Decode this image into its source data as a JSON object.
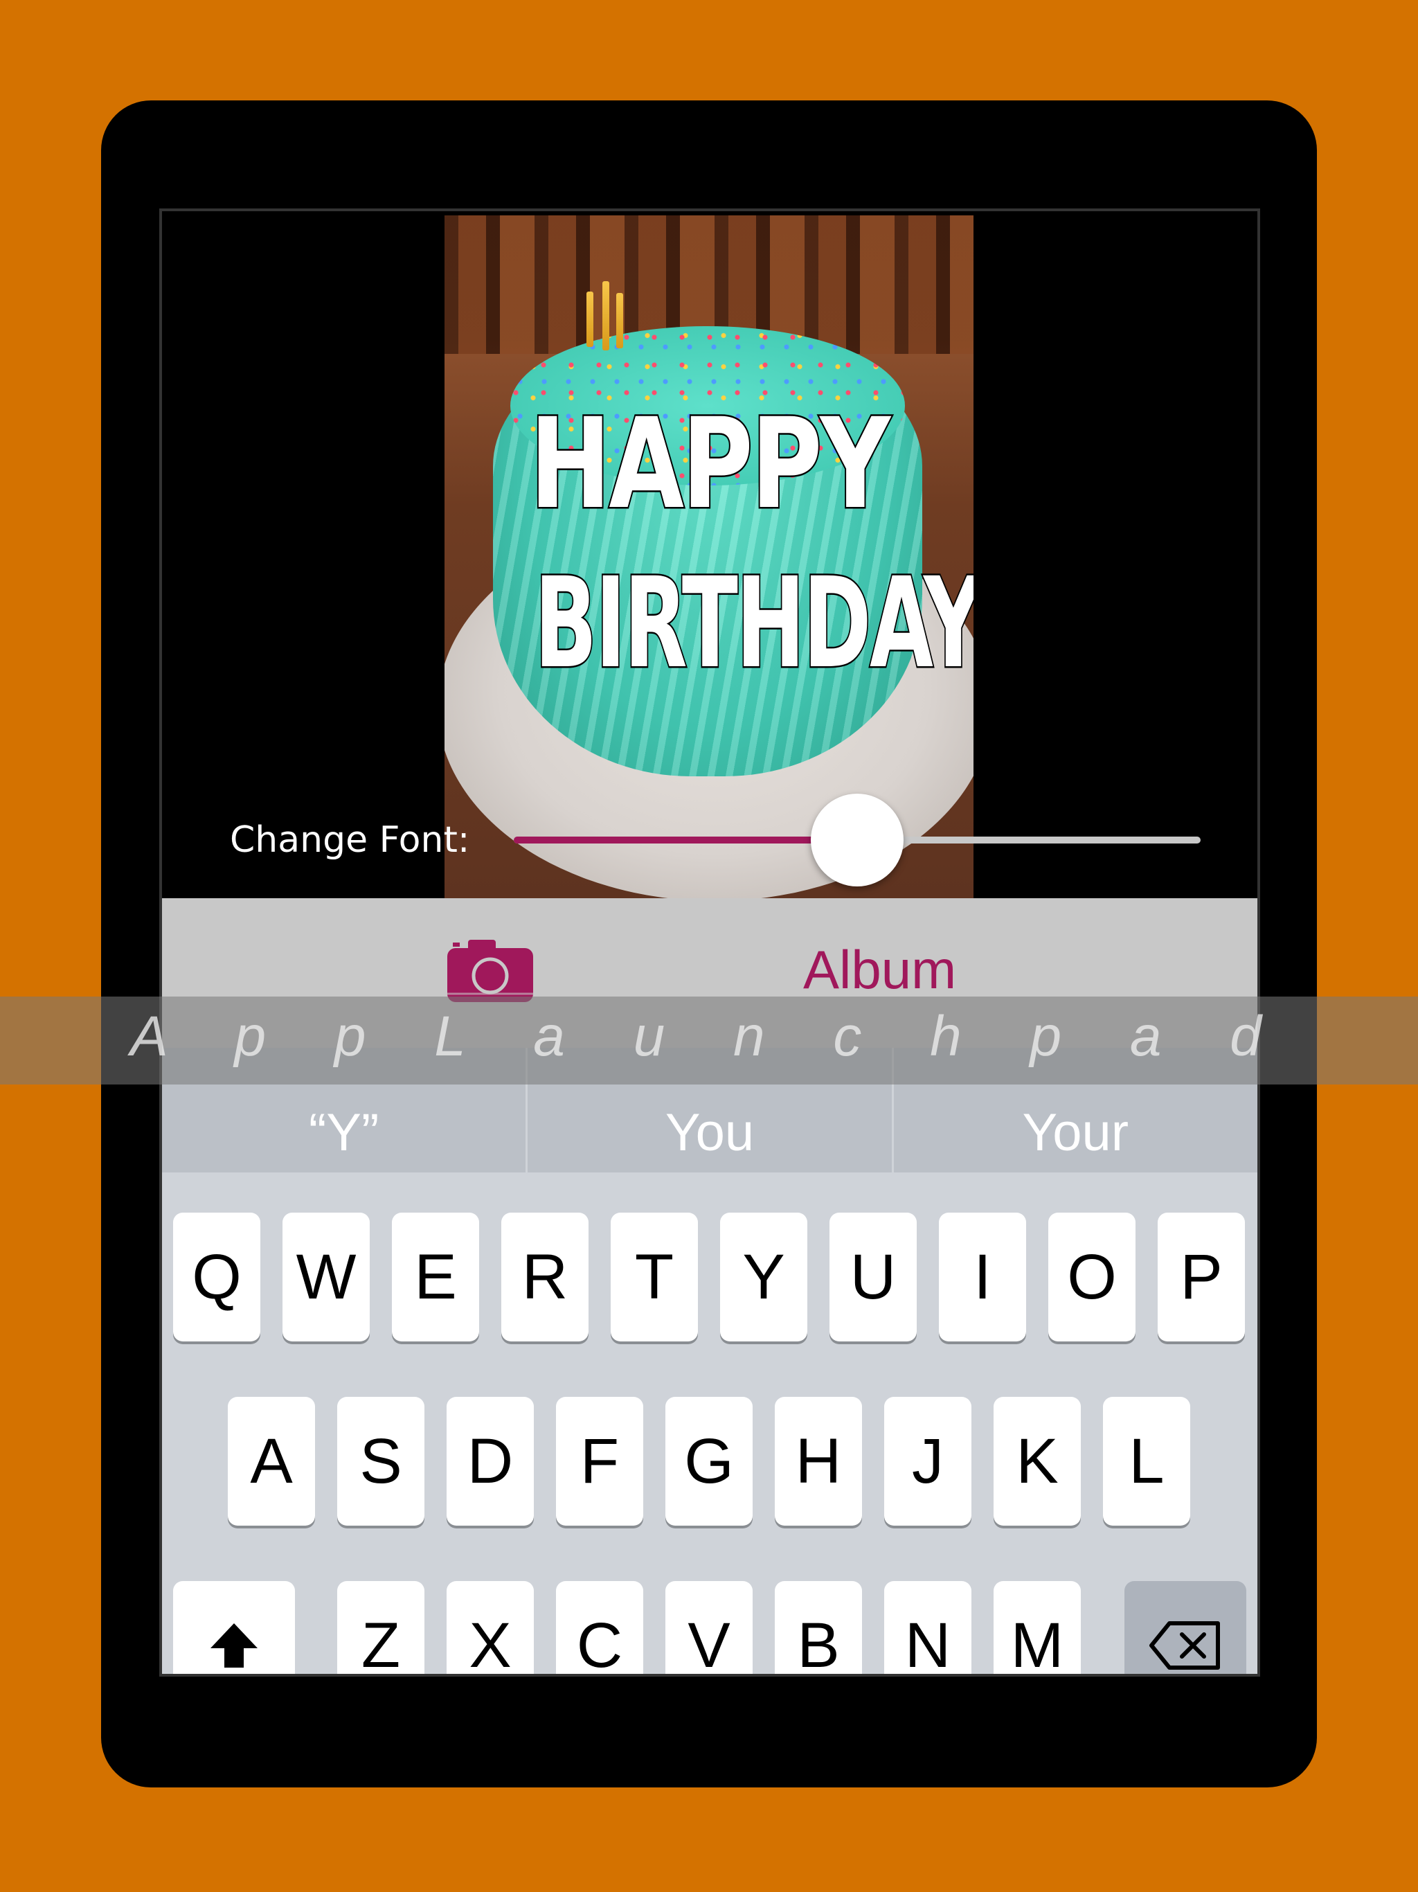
{
  "photo": {
    "caption_line1": "HAPPY",
    "caption_line2": "BIRTHDAY"
  },
  "font_slider": {
    "label": "Change Font:",
    "value_fraction": 0.5,
    "accent": "#a0185b"
  },
  "toolbar": {
    "camera_icon": "camera-icon",
    "album_label": "Album",
    "accent": "#a0185b"
  },
  "suggestions": [
    "“Y”",
    "You",
    "Your"
  ],
  "keyboard": {
    "row1": [
      "Q",
      "W",
      "E",
      "R",
      "T",
      "Y",
      "U",
      "I",
      "O",
      "P"
    ],
    "row2": [
      "A",
      "S",
      "D",
      "F",
      "G",
      "H",
      "J",
      "K",
      "L"
    ],
    "row3": [
      "Z",
      "X",
      "C",
      "V",
      "B",
      "N",
      "M"
    ],
    "shift_icon": "shift-arrow-icon",
    "delete_icon": "backspace-icon"
  },
  "watermark": {
    "text": "A p p L a u n c h p a d"
  },
  "colors": {
    "background": "#d47200",
    "device": "#000000"
  }
}
